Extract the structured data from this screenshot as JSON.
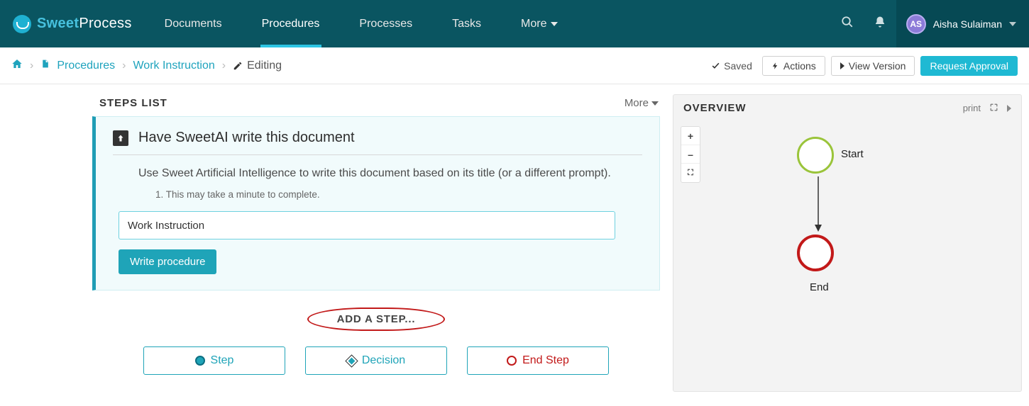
{
  "brand": {
    "part1": "Sweet",
    "part2": "Process"
  },
  "nav": {
    "items": [
      "Documents",
      "Procedures",
      "Processes",
      "Tasks",
      "More"
    ]
  },
  "user": {
    "initials": "AS",
    "name": "Aisha Sulaiman"
  },
  "crumbs": {
    "procedures": "Procedures",
    "doc": "Work Instruction",
    "editing": "Editing"
  },
  "toolbar": {
    "saved": "Saved",
    "actions": "Actions",
    "view_version": "View Version",
    "request_approval": "Request Approval"
  },
  "steps_panel": {
    "title": "STEPS LIST",
    "more": "More"
  },
  "ai_card": {
    "title": "Have SweetAI write this document",
    "desc": "Use Sweet Artificial Intelligence to write this document based on its title (or a different prompt).",
    "note": "1. This may take a minute to complete.",
    "input_value": "Work Instruction",
    "button": "Write procedure"
  },
  "add_step": {
    "label": "ADD A STEP...",
    "step": "Step",
    "decision": "Decision",
    "end": "End Step"
  },
  "overview": {
    "title": "OVERVIEW",
    "print": "print",
    "start": "Start",
    "end": "End"
  }
}
